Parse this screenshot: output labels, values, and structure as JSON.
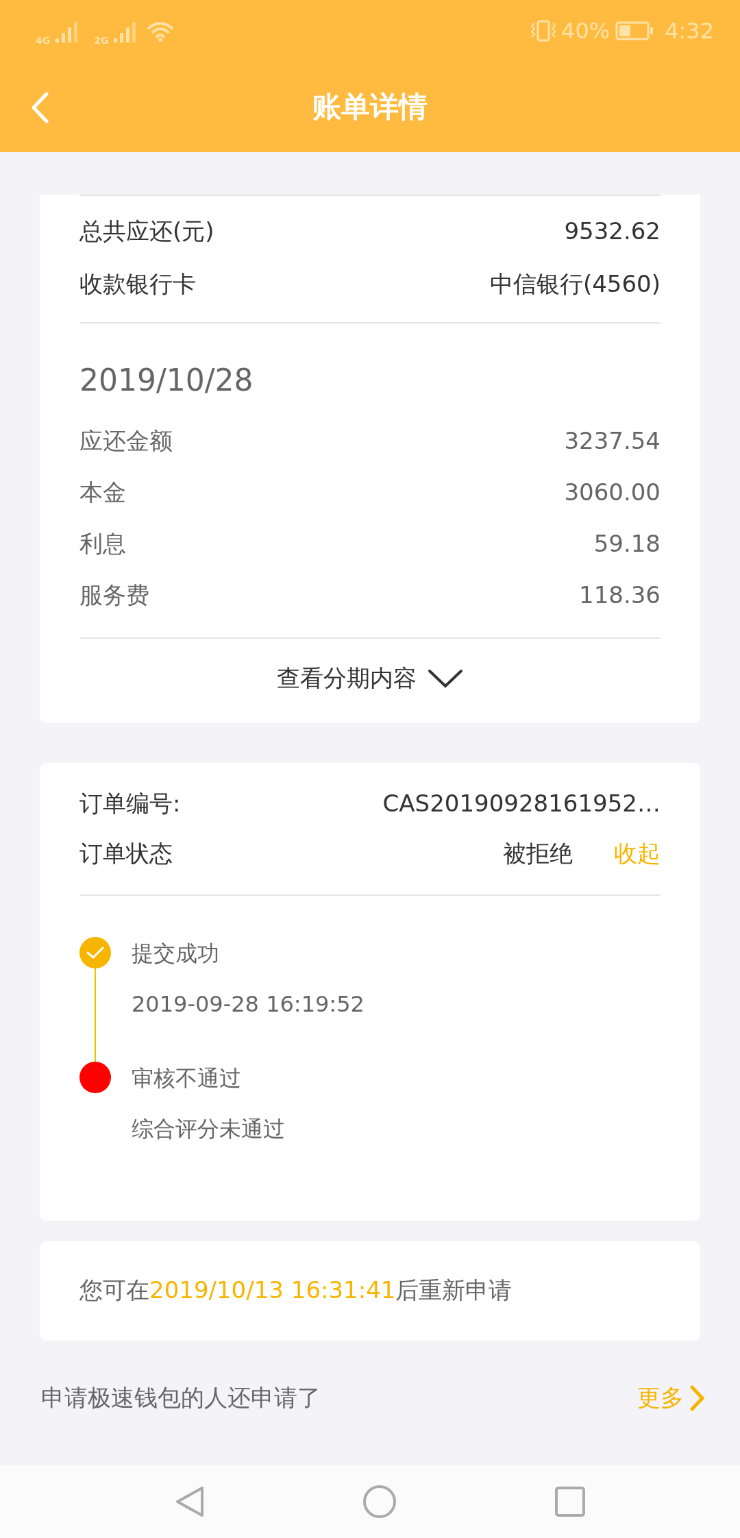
{
  "status_bar": {
    "network_1": "4G",
    "network_2": "2G",
    "battery_percent": "40%",
    "time": "4:32"
  },
  "header": {
    "title": "账单详情"
  },
  "summary": [
    {
      "label": "总共应还(元)",
      "value": "9532.62"
    },
    {
      "label": "收款银行卡",
      "value": "中信银行(4560)"
    }
  ],
  "installment": {
    "date": "2019/10/28",
    "rows": [
      {
        "label": "应还金额",
        "value": "3237.54"
      },
      {
        "label": "本金",
        "value": "3060.00"
      },
      {
        "label": "利息",
        "value": "59.18"
      },
      {
        "label": "服务费",
        "value": "118.36"
      }
    ],
    "toggle": "查看分期内容"
  },
  "order": {
    "rows": [
      {
        "label": "订单编号:",
        "value": "CAS20190928161952…"
      },
      {
        "label": "订单状态",
        "value": "被拒绝",
        "action": "收起"
      }
    ],
    "timeline": [
      {
        "kind": "done",
        "title": "提交成功",
        "detail": "2019-09-28 16:19:52",
        "color": "#f7b500"
      },
      {
        "kind": "failed",
        "title": "审核不通过",
        "detail": "综合评分未通过",
        "color": "#ff0000"
      }
    ]
  },
  "notice": {
    "prefix": "您可在",
    "highlight": "2019/10/13 16:31:41",
    "suffix": "后重新申请"
  },
  "recommend": {
    "title": "申请极速钱包的人还申请了",
    "more": "更多"
  }
}
